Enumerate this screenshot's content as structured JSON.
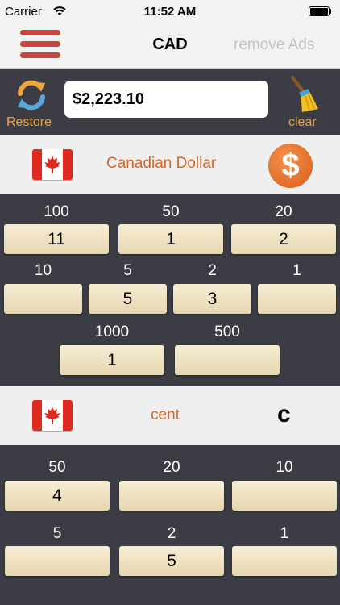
{
  "status_bar": {
    "carrier": "Carrier",
    "time": "11:52 AM"
  },
  "nav": {
    "title": "CAD",
    "remove_ads": "remove Ads"
  },
  "toolbar": {
    "restore_label": "Restore",
    "amount": "$2,223.10",
    "clear_label": "clear"
  },
  "dollar_section": {
    "name": "Canadian Dollar",
    "symbol": "$",
    "denoms": [
      {
        "label": "100",
        "count": "11"
      },
      {
        "label": "50",
        "count": "1"
      },
      {
        "label": "20",
        "count": "2"
      },
      {
        "label": "10",
        "count": ""
      },
      {
        "label": "5",
        "count": "5"
      },
      {
        "label": "2",
        "count": "3"
      },
      {
        "label": "1",
        "count": ""
      },
      {
        "label": "1000",
        "count": "1"
      },
      {
        "label": "500",
        "count": ""
      }
    ]
  },
  "cent_section": {
    "name": "cent",
    "symbol": "c",
    "denoms": [
      {
        "label": "50",
        "count": "4"
      },
      {
        "label": "20",
        "count": ""
      },
      {
        "label": "10",
        "count": ""
      },
      {
        "label": "5",
        "count": ""
      },
      {
        "label": "2",
        "count": "5"
      },
      {
        "label": "1",
        "count": ""
      }
    ]
  },
  "colors": {
    "accent": "#d0682b",
    "background": "#3b3c44",
    "hamburger": "#c9463c"
  }
}
